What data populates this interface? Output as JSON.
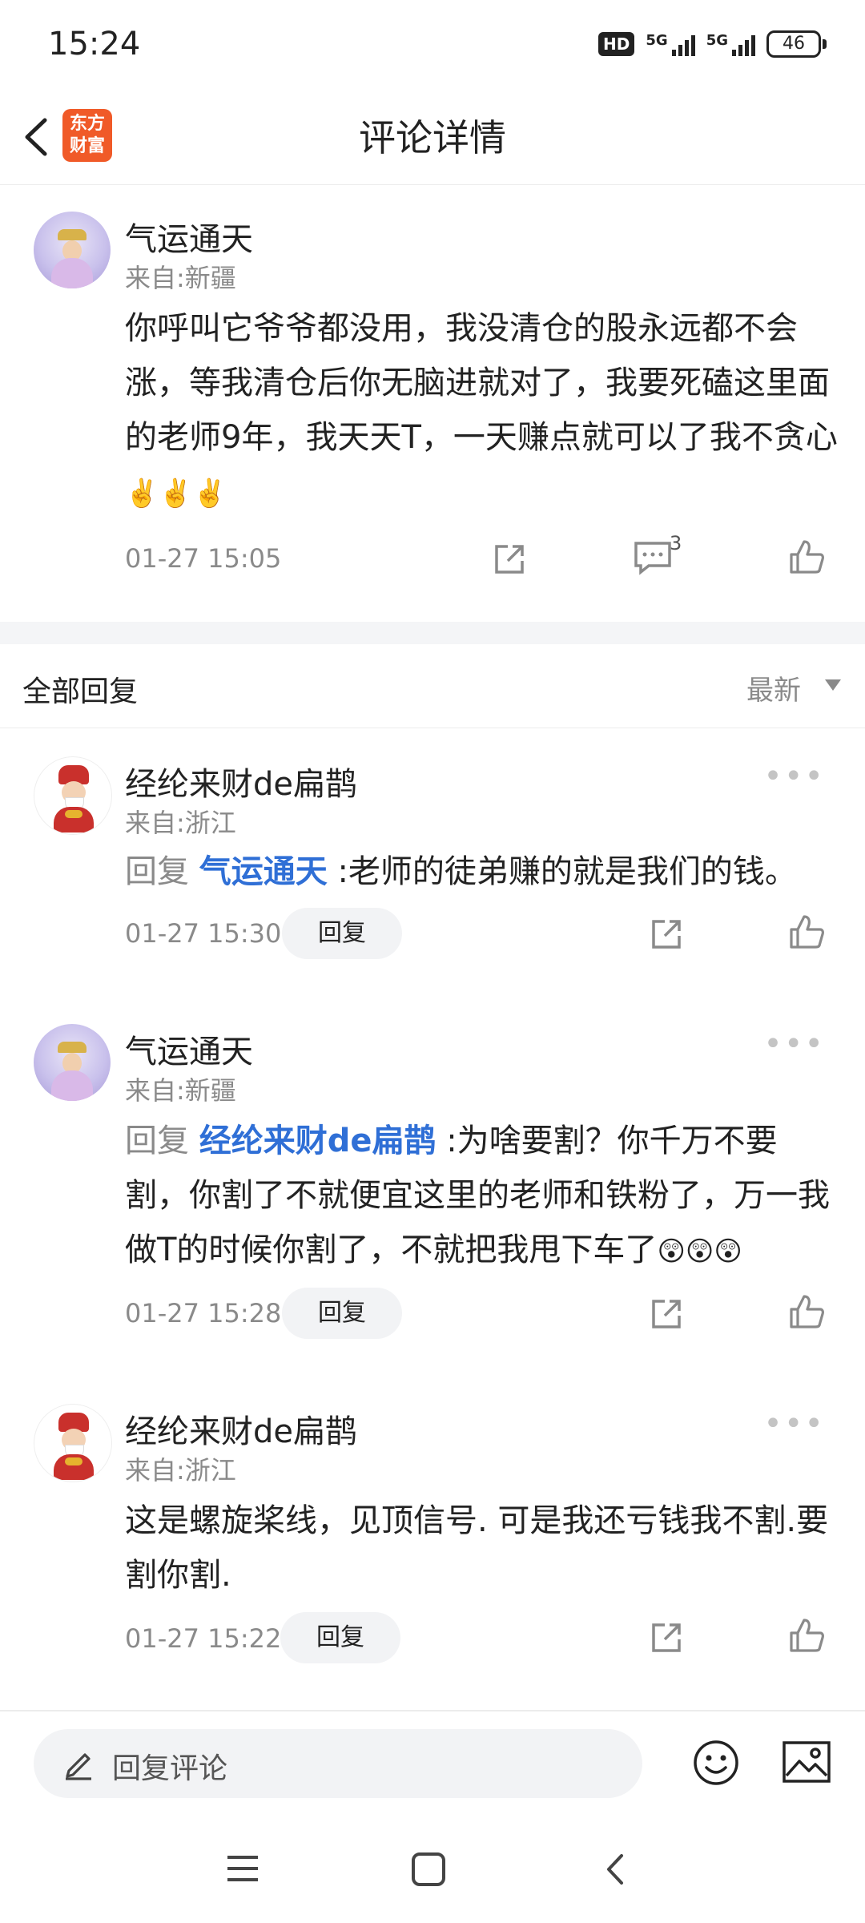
{
  "status_bar": {
    "time": "15:24",
    "hd_label": "HD",
    "signal1_label": "5G",
    "signal2_label": "5G",
    "battery": "46"
  },
  "header": {
    "title": "评论详情",
    "logo_line1": "东方",
    "logo_line2": "财富"
  },
  "main_comment": {
    "username": "气运通天",
    "location": "来自:新疆",
    "text": "你呼叫它爷爷都没用，我没清仓的股永远都不会涨，等我清仓后你无脑进就对了，我要死磕这里面的老师9年，我天天T，一天赚点就可以了我不贪心",
    "emoji": "✌️✌️✌️",
    "timestamp": "01-27 15:05",
    "reply_count": "3"
  },
  "replies_section": {
    "title": "全部回复",
    "sort": "最新"
  },
  "replies": [
    {
      "username": "经纶来财de扁鹊",
      "location": "来自:浙江",
      "reply_word": "回复",
      "mention": "气运通天",
      "text": ":老师的徒弟赚的就是我们的钱。",
      "timestamp": "01-27 15:30",
      "reply_button": "回复"
    },
    {
      "username": "气运通天",
      "location": "来自:新疆",
      "reply_word": "回复",
      "mention": "经纶来财de扁鹊",
      "text": ":为啥要割？你千万不要割，你割了不就便宜这里的老师和铁粉了，万一我做T的时候你割了，不就把我甩下车了",
      "emoji": "😲😲😲",
      "timestamp": "01-27 15:28",
      "reply_button": "回复"
    },
    {
      "username": "经纶来财de扁鹊",
      "location": "来自:浙江",
      "text": "这是螺旋桨线，见顶信号.   可是我还亏钱我不割.要割你割.",
      "timestamp": "01-27 15:22",
      "reply_button": "回复"
    }
  ],
  "bottom_bar": {
    "input_placeholder": "回复评论"
  },
  "icons": {
    "pencil": "pencil-icon",
    "emoji": "smiley-icon",
    "image": "image-icon",
    "share": "share-icon",
    "comment": "comment-icon",
    "like": "thumbs-up-icon"
  }
}
